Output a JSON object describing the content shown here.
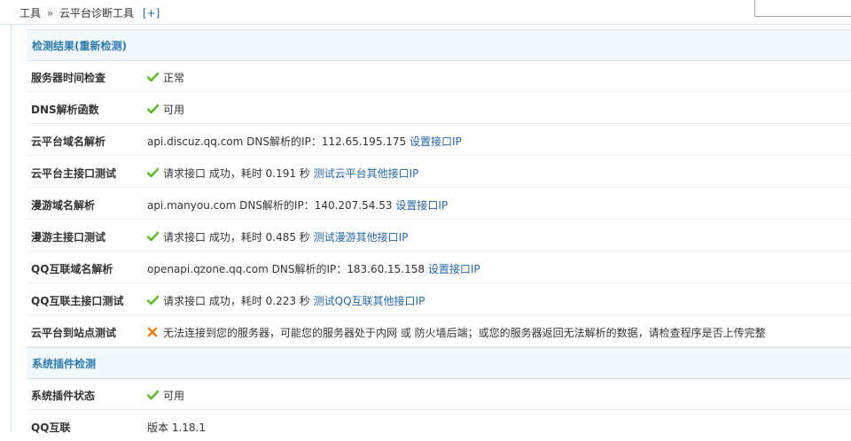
{
  "breadcrumb": {
    "root": "工具",
    "separator": "»",
    "current": "云平台诊断工具",
    "expand": "[+]"
  },
  "sections": {
    "results_title": "检测结果(重新检测)",
    "plugins_title": "系统插件检测"
  },
  "rows": {
    "server_time": {
      "label": "服务器时间检查",
      "value": "正常"
    },
    "dns_func": {
      "label": "DNS解析函数",
      "value": "可用"
    },
    "cloud_domain": {
      "label": "云平台域名解析",
      "value": "api.discuz.qq.com DNS解析的IP：112.65.195.175",
      "link": "设置接口IP"
    },
    "cloud_main": {
      "label": "云平台主接口测试",
      "value": "请求接口 成功，耗时 0.191 秒",
      "link": "测试云平台其他接口IP"
    },
    "manyou_domain": {
      "label": "漫游域名解析",
      "value": "api.manyou.com DNS解析的IP：140.207.54.53",
      "link": "设置接口IP"
    },
    "manyou_main": {
      "label": "漫游主接口测试",
      "value": "请求接口 成功，耗时 0.485 秒",
      "link": "测试漫游其他接口IP"
    },
    "qq_domain": {
      "label": "QQ互联域名解析",
      "value": "openapi.qzone.qq.com DNS解析的IP：183.60.15.158",
      "link": "设置接口IP"
    },
    "qq_main": {
      "label": "QQ互联主接口测试",
      "value": "请求接口 成功，耗时 0.223 秒",
      "link": "测试QQ互联其他接口IP"
    },
    "cloud_site": {
      "label": "云平台到站点测试",
      "value": "无法连接到您的服务器，可能您的服务器处于内网 或 防火墙后端；或您的服务器返回无法解析的数据，请检查程序是否上传完整"
    },
    "plugin_status": {
      "label": "系统插件状态",
      "value": "可用"
    },
    "qq_connect": {
      "label": "QQ互联",
      "value": "版本 1.18.1"
    }
  },
  "colors": {
    "ok": "#5fb92c",
    "error": "#f07d1a",
    "link": "#2366a8",
    "section_title": "#2a7ab0",
    "section_bg": "#f2f9fd"
  },
  "icons": {
    "ok": "check-icon",
    "error": "cross-icon"
  }
}
